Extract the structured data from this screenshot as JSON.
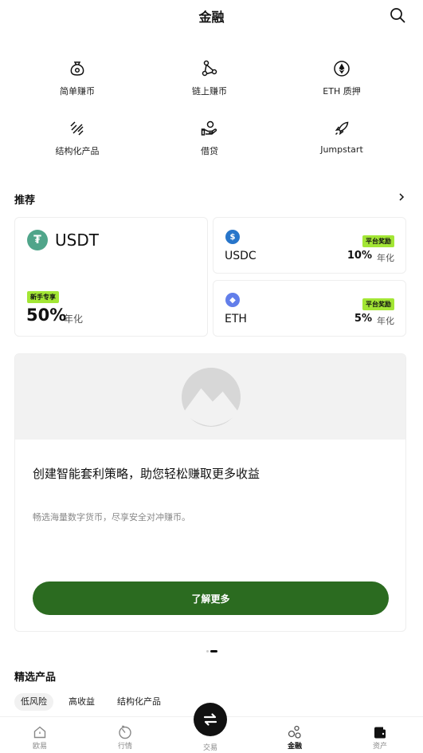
{
  "header": {
    "title": "金融"
  },
  "quick_actions": [
    {
      "label": "简单赚币",
      "icon": "money-bag-icon"
    },
    {
      "label": "链上赚币",
      "icon": "nodes-icon"
    },
    {
      "label": "ETH 质押",
      "icon": "ethereum-icon"
    },
    {
      "label": "结构化产品",
      "icon": "structure-icon"
    },
    {
      "label": "借贷",
      "icon": "loan-hand-icon"
    },
    {
      "label": "Jumpstart",
      "icon": "rocket-icon"
    }
  ],
  "recommend": {
    "title": "推荐",
    "featured": {
      "coin": "USDT",
      "coin_glyph": "₮",
      "coin_color": "#50a58a",
      "badge": "新手专享",
      "rate": "50%",
      "unit": "年化"
    },
    "cards": [
      {
        "coin": "USDC",
        "coin_glyph": "$",
        "coin_color": "#2775ca",
        "badge": "平台奖励",
        "rate": "10%",
        "unit": "年化"
      },
      {
        "coin": "ETH",
        "coin_glyph": "◆",
        "coin_color": "#627eea",
        "badge": "平台奖励",
        "rate": "5%",
        "unit": "年化"
      }
    ]
  },
  "promo": {
    "headline": "创建智能套利策略，助您轻松赚取更多收益",
    "subtext": "畅选海量数字货币，尽享安全对冲赚币。",
    "button": "了解更多"
  },
  "carousel": {
    "count": 2,
    "active": 2
  },
  "selected": {
    "title": "精选产品",
    "filters": [
      "低风险",
      "高收益",
      "结构化产品"
    ],
    "active_filter": "低风险"
  },
  "tabbar": {
    "tabs": [
      "欧易",
      "行情",
      "交易",
      "金融",
      "资产"
    ],
    "active": "金融"
  },
  "colors": {
    "accent_green": "#2b6b20",
    "badge_lime": "#a3e635"
  }
}
